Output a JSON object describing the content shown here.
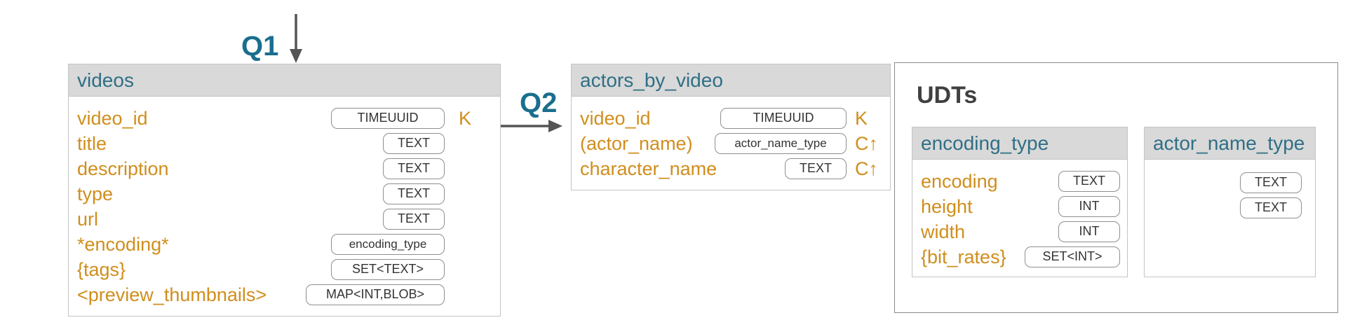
{
  "labels": {
    "q1": "Q1",
    "q2": "Q2",
    "udts_title": "UDTs"
  },
  "videos": {
    "title": "videos",
    "fields": [
      {
        "name": "video_id",
        "type": "TIMEUUID",
        "key": "K"
      },
      {
        "name": "title",
        "type": "TEXT",
        "key": ""
      },
      {
        "name": "description",
        "type": "TEXT",
        "key": ""
      },
      {
        "name": "type",
        "type": "TEXT",
        "key": ""
      },
      {
        "name": "url",
        "type": "TEXT",
        "key": ""
      },
      {
        "name": "*encoding*",
        "type": "encoding_type",
        "key": ""
      },
      {
        "name": "{tags}",
        "type": "SET<TEXT>",
        "key": ""
      },
      {
        "name": "<preview_thumbnails>",
        "type": "MAP<INT,BLOB>",
        "key": ""
      }
    ]
  },
  "actors_by_video": {
    "title": "actors_by_video",
    "fields": [
      {
        "name": "video_id",
        "type": "TIMEUUID",
        "key": "K"
      },
      {
        "name": "(actor_name)",
        "type": "actor_name_type",
        "key": "C↑"
      },
      {
        "name": "character_name",
        "type": "TEXT",
        "key": "C↑"
      }
    ]
  },
  "encoding_type": {
    "title": "encoding_type",
    "fields": [
      {
        "name": "encoding",
        "type": "TEXT"
      },
      {
        "name": "height",
        "type": "INT"
      },
      {
        "name": "width",
        "type": "INT"
      },
      {
        "name": "{bit_rates}",
        "type": "SET<INT>"
      }
    ]
  },
  "actor_name_type": {
    "title": "actor_name_type",
    "fields": [
      {
        "name": "",
        "type": "TEXT"
      },
      {
        "name": "",
        "type": "TEXT"
      }
    ]
  },
  "colors": {
    "field": "#d08e1d",
    "header_text": "#2f6f85",
    "query_label": "#1a6e8e"
  }
}
